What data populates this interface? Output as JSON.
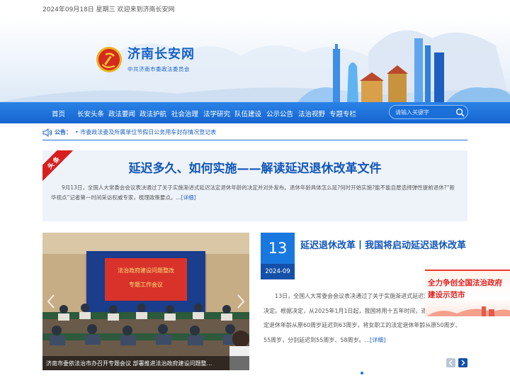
{
  "topbar": {
    "date_text": "2024年09月18日 星期三 欢迎来到济南长安网"
  },
  "header": {
    "site_title": "济南长安网",
    "site_subtitle": "中共济南市委政法委员会",
    "emblem_icon": "party-emblem-icon"
  },
  "nav": {
    "items": [
      "首页",
      "长安头条",
      "政法要闻",
      "政法护航",
      "社会治理",
      "法学研究",
      "队伍建设",
      "公示公告",
      "法治视野",
      "专题专栏"
    ]
  },
  "search": {
    "placeholder": "请输入关键字",
    "icon": "search-icon"
  },
  "notice": {
    "label": "公告：",
    "text": "• 市委政法委及所属单位节假日公务用车封存情况登记表"
  },
  "headline": {
    "tag": "头条",
    "title": "延迟多久、如何实施——解读延迟退休改革文件",
    "summary": "9月13日，全国人大常委会会议表决通过了关于实施渐进式延迟法定退休年龄的决定并对外发布。退休年龄具体怎么延?何时开始实施?能不能自愿选择弹性提前退休?“新华视点”记者第一时间采访权威专家，梳理政策要点。...",
    "more": "[详细]"
  },
  "slideshow": {
    "caption": "济南市委依法治市办召开专题会议 部署推进法治政府建设问题整...",
    "screen_line1": "法治政府建设问题整改",
    "screen_line2": "专题工作会议"
  },
  "news": {
    "day": "13",
    "year_month": "2024-09",
    "title": "延迟退休改革丨我国将启动延迟退休改革",
    "summary": "13日，全国人大常委会会议表决通过了关于实施渐进式延迟法定退休年龄的决定。根据决定，从2025年1月1日起，我国将用十五年时间，逐步将男职工的法定退休年龄从原60周岁延迟到63周岁，将女职工的法定退休年龄从原50周岁、55周岁，分别延迟到55周岁、58周岁。...",
    "more": "[详细]"
  },
  "float_banner": {
    "line1": "全力争创全国法治政府",
    "line2": "建设示范市"
  },
  "colors": {
    "brand_blue": "#1661c7",
    "nav_blue": "#1565cf",
    "accent_red": "#d81e1e"
  }
}
